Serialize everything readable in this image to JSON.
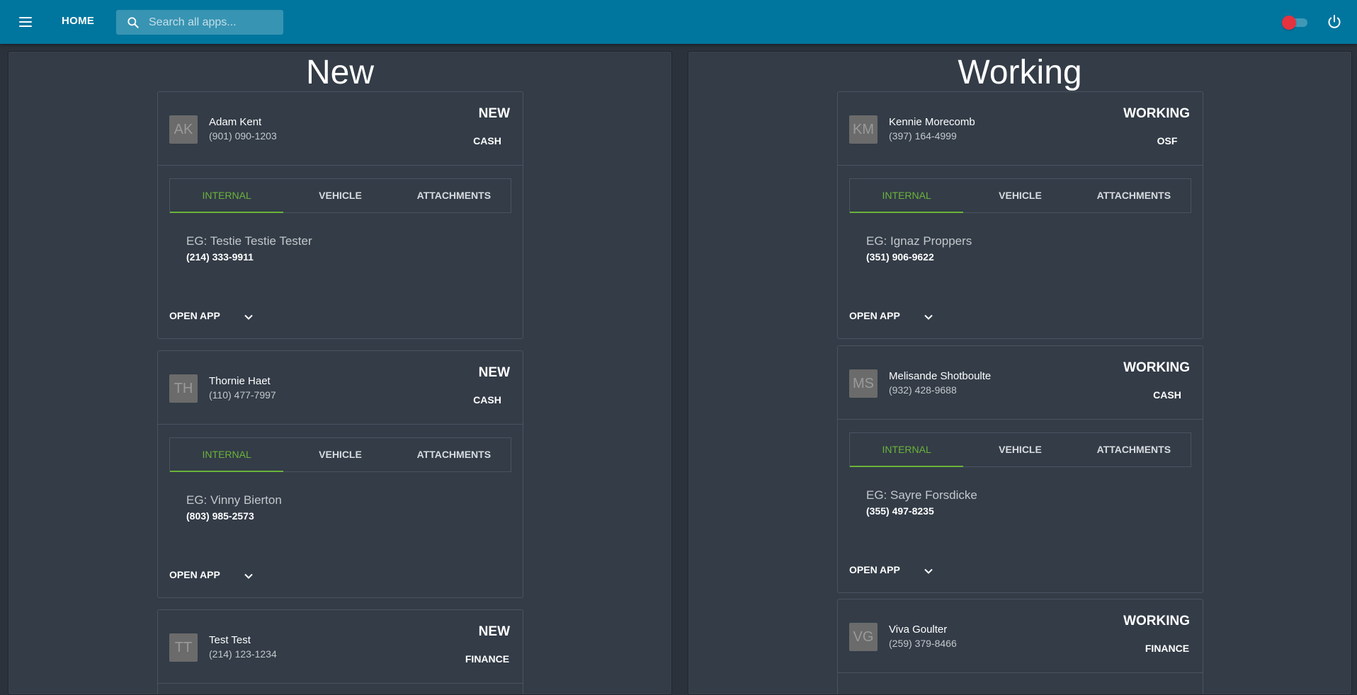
{
  "header": {
    "home_label": "HOME",
    "search_placeholder": "Search all apps...",
    "toggle_color": "#e5323f",
    "brand_color": "#00769e",
    "icons": [
      "menu-icon",
      "search-icon",
      "power-icon"
    ]
  },
  "labels": {
    "tabs": [
      "INTERNAL",
      "VEHICLE",
      "ATTACHMENTS"
    ],
    "open_app": "OPEN APP",
    "active_tab_color": "#6bb33a"
  },
  "columns": [
    {
      "title": "New",
      "cards": [
        {
          "initials": "AK",
          "name": "Adam Kent",
          "phone": "(901) 090-1203",
          "status": "NEW",
          "type": "CASH",
          "eg_name": "EG: Testie Testie Tester",
          "eg_phone": "(214) 333-9911"
        },
        {
          "initials": "TH",
          "name": "Thornie Haet",
          "phone": "(110) 477-7997",
          "status": "NEW",
          "type": "CASH",
          "eg_name": "EG: Vinny Bierton",
          "eg_phone": "(803) 985-2573"
        },
        {
          "initials": "TT",
          "name": "Test Test",
          "phone": "(214) 123-1234",
          "status": "NEW",
          "type": "FINANCE"
        }
      ]
    },
    {
      "title": "Working",
      "cards": [
        {
          "initials": "KM",
          "name": "Kennie Morecomb",
          "phone": "(397) 164-4999",
          "status": "WORKING",
          "type": "OSF",
          "eg_name": "EG: Ignaz Proppers",
          "eg_phone": "(351) 906-9622"
        },
        {
          "initials": "MS",
          "name": "Melisande Shotboulte",
          "phone": "(932) 428-9688",
          "status": "WORKING",
          "type": "CASH",
          "eg_name": "EG: Sayre Forsdicke",
          "eg_phone": "(355) 497-8235"
        },
        {
          "initials": "VG",
          "name": "Viva Goulter",
          "phone": "(259) 379-8466",
          "status": "WORKING",
          "type": "FINANCE"
        }
      ]
    }
  ]
}
